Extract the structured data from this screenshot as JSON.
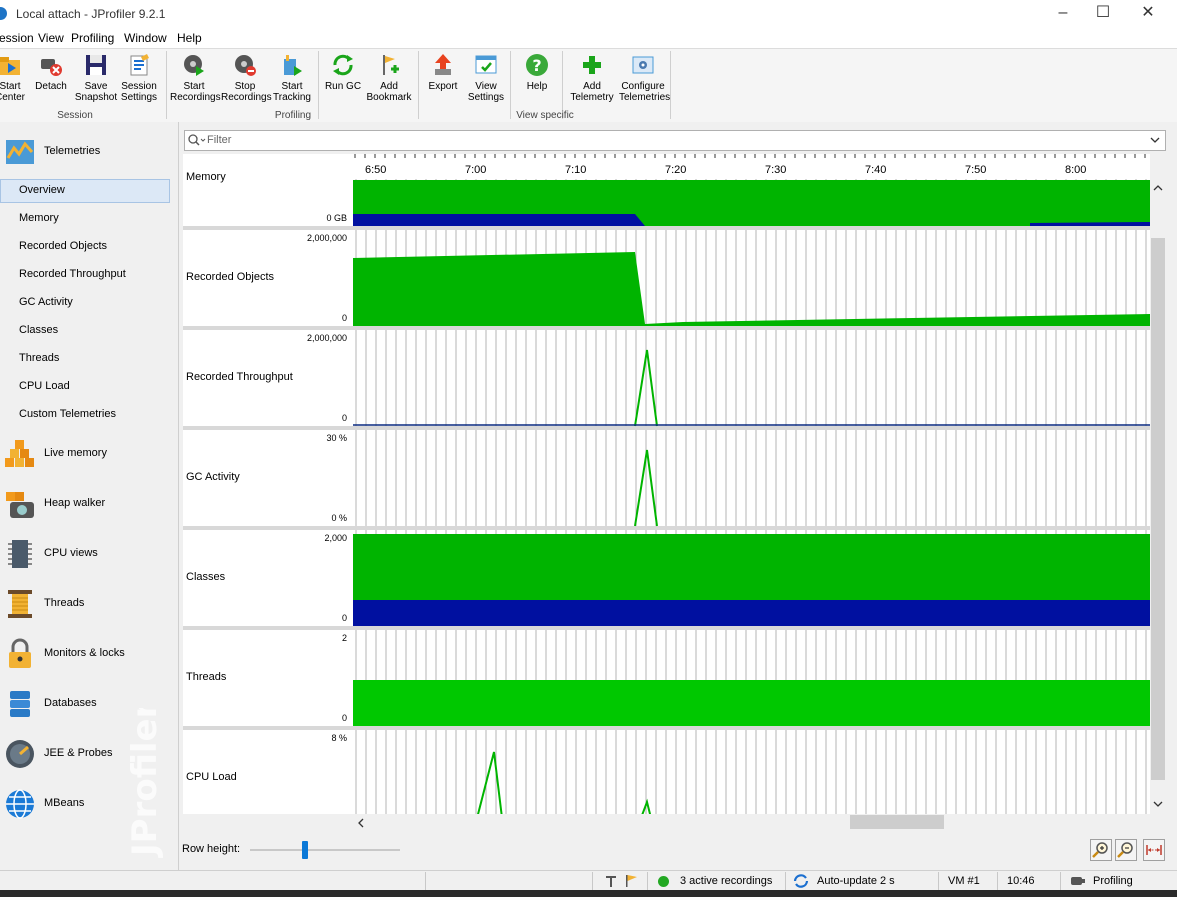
{
  "window": {
    "title": "Local attach - JProfiler 9.2.1",
    "minimize": "–",
    "maximize": "☐",
    "close": "✕"
  },
  "menu": [
    "ession",
    "View",
    "Profiling",
    "Window",
    "Help"
  ],
  "toolbar": {
    "buttons": [
      {
        "line1": "Start",
        "line2": "Center",
        "icon": "start-center-icon"
      },
      {
        "line1": "Detach",
        "line2": "",
        "icon": "detach-icon"
      },
      {
        "line1": "Save",
        "line2": "Snapshot",
        "icon": "save-snapshot-icon"
      },
      {
        "line1": "Session",
        "line2": "Settings",
        "icon": "session-settings-icon"
      },
      {
        "line1": "Start",
        "line2": "Recordings",
        "icon": "start-recordings-icon"
      },
      {
        "line1": "Stop",
        "line2": "Recordings",
        "icon": "stop-recordings-icon"
      },
      {
        "line1": "Start",
        "line2": "Tracking",
        "icon": "start-tracking-icon"
      },
      {
        "line1": "Run GC",
        "line2": "",
        "icon": "run-gc-icon"
      },
      {
        "line1": "Add",
        "line2": "Bookmark",
        "icon": "add-bookmark-icon"
      },
      {
        "line1": "Export",
        "line2": "",
        "icon": "export-icon"
      },
      {
        "line1": "View",
        "line2": "Settings",
        "icon": "view-settings-icon"
      },
      {
        "line1": "Help",
        "line2": "",
        "icon": "help-icon"
      },
      {
        "line1": "Add",
        "line2": "Telemetry",
        "icon": "add-telemetry-icon"
      },
      {
        "line1": "Configure",
        "line2": "Telemetries",
        "icon": "configure-telemetries-icon"
      }
    ],
    "groups": [
      "Session",
      "Profiling",
      "View specific"
    ]
  },
  "sidebar": {
    "header": "Telemetries",
    "items": [
      "Overview",
      "Memory",
      "Recorded Objects",
      "Recorded Throughput",
      "GC Activity",
      "Classes",
      "Threads",
      "CPU Load",
      "Custom Telemetries"
    ],
    "selected": "Overview",
    "sections": [
      "Live memory",
      "Heap walker",
      "CPU views",
      "Threads",
      "Monitors & locks",
      "Databases",
      "JEE & Probes",
      "MBeans"
    ],
    "watermark": "JProfiler"
  },
  "filter": {
    "placeholder": "Filter"
  },
  "time_axis": [
    "6:50",
    "7:00",
    "7:10",
    "7:20",
    "7:30",
    "7:40",
    "7:50",
    "8:00"
  ],
  "panels": [
    {
      "label": "Memory",
      "ymax": "",
      "ymin": "0 GB"
    },
    {
      "label": "Recorded Objects",
      "ymax": "2,000,000",
      "ymin": "0"
    },
    {
      "label": "Recorded Throughput",
      "ymax": "2,000,000",
      "ymin": "0"
    },
    {
      "label": "GC Activity",
      "ymax": "30 %",
      "ymin": "0 %"
    },
    {
      "label": "Classes",
      "ymax": "2,000",
      "ymin": "0"
    },
    {
      "label": "Threads",
      "ymax": "2",
      "ymin": "0"
    },
    {
      "label": "CPU Load",
      "ymax": "8 %",
      "ymin": ""
    }
  ],
  "row_height_label": "Row height:",
  "status": {
    "recordings": "3 active recordings",
    "autoupdate": "Auto-update 2 s",
    "vm": "VM #1",
    "time": "10:46",
    "mode": "Profiling"
  },
  "colors": {
    "green": "#00b400",
    "green_light": "#00c800",
    "blue": "#0010a0",
    "grid": "#b4b4b4"
  }
}
